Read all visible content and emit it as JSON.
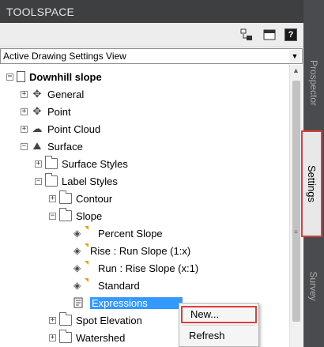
{
  "window": {
    "title": "TOOLSPACE"
  },
  "toolbar": {
    "help_label": "?"
  },
  "view_select": {
    "value": "Active Drawing Settings View"
  },
  "side_tabs": {
    "prospector": "Prospector",
    "settings": "Settings",
    "survey": "Survey"
  },
  "tree": {
    "root": "Downhill slope",
    "general": "General",
    "point": "Point",
    "point_cloud": "Point Cloud",
    "surface": "Surface",
    "surface_styles": "Surface Styles",
    "label_styles": "Label Styles",
    "contour": "Contour",
    "slope": "Slope",
    "percent_slope": "Percent Slope",
    "rise_run": "Rise : Run Slope (1:x)",
    "run_rise": "Run : Rise Slope (x:1)",
    "standard": "Standard",
    "expressions": "Expressions",
    "spot_elevation": "Spot Elevation",
    "watershed": "Watershed"
  },
  "expander": {
    "plus": "+",
    "minus": "−"
  },
  "context_menu": {
    "new": "New...",
    "refresh": "Refresh"
  },
  "scrollbar": {
    "up_arrow": "▲",
    "grip": "≡"
  },
  "icons": {
    "gear": "⚙",
    "style": "◈",
    "point": "✥",
    "cloud": "☁",
    "surface": "⛰",
    "general": "✥",
    "dropdown": "▼"
  }
}
